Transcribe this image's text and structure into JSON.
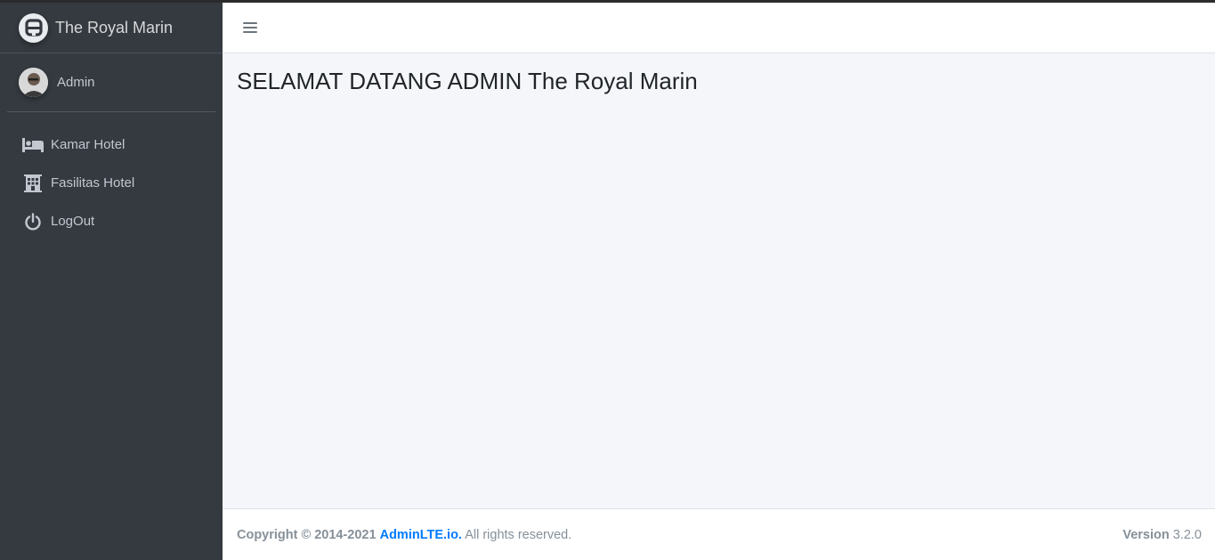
{
  "brand": {
    "title": "The Royal Marin",
    "logo_icon": "adminlte-logo-icon"
  },
  "user": {
    "name": "Admin",
    "avatar_icon": "user-avatar"
  },
  "sidebar": {
    "items": [
      {
        "label": "Kamar Hotel",
        "icon": "bed-icon"
      },
      {
        "label": "Fasilitas Hotel",
        "icon": "building-icon"
      },
      {
        "label": "LogOut",
        "icon": "power-icon"
      }
    ]
  },
  "navbar": {
    "toggle_icon": "hamburger-menu-icon"
  },
  "main": {
    "title": "SELAMAT DATANG ADMIN The Royal Marin"
  },
  "footer": {
    "copyright_prefix": "Copyright © 2014-2021",
    "link_text": "AdminLTE.io.",
    "suffix": "All rights reserved.",
    "version_label": "Version",
    "version_number": "3.2.0",
    "link_color": "#007bff"
  },
  "colors": {
    "sidebar_bg": "#343a40",
    "content_bg": "#f4f6f9",
    "accent": "#007bff"
  }
}
